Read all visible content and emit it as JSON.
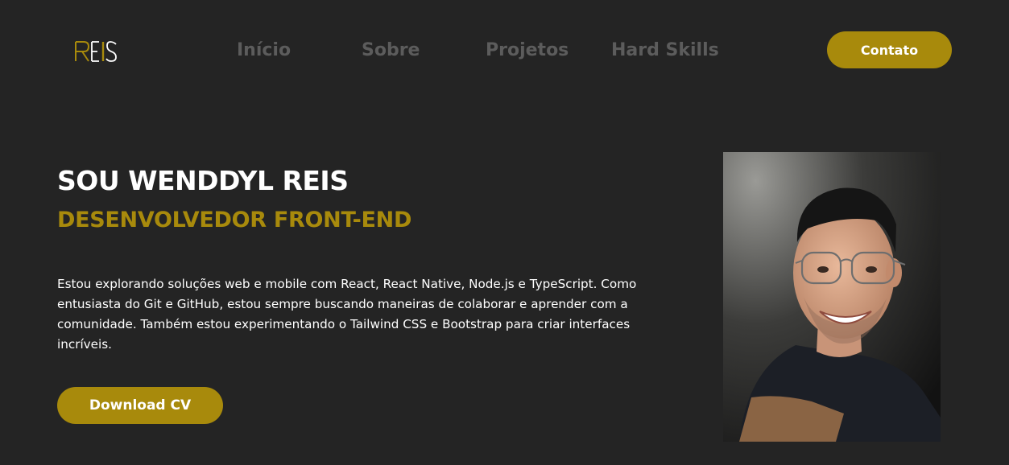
{
  "header": {
    "logo_text": "REIS",
    "nav": [
      {
        "label": "Início"
      },
      {
        "label": "Sobre"
      },
      {
        "label": "Projetos"
      },
      {
        "label": "Hard Skills"
      }
    ],
    "contact_label": "Contato"
  },
  "hero": {
    "title": "SOU WENDDYL REIS",
    "subtitle": "DESENVOLVEDOR FRONT-END",
    "description": "Estou explorando soluções web e mobile com React, React Native, Node.js e TypeScript. Como entusiasta do Git e GitHub, estou sempre buscando maneiras de colaborar e aprender com a comunidade. Também estou experimentando o Tailwind CSS e Bootstrap para criar interfaces incríveis.",
    "download_label": "Download CV"
  },
  "colors": {
    "background": "#242424",
    "accent": "#a88a0c",
    "nav_text": "#5c5c5c",
    "text": "#ffffff"
  }
}
